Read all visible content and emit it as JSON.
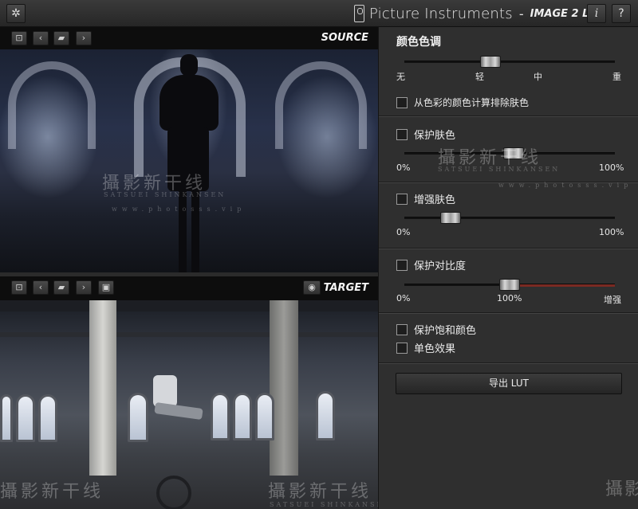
{
  "titlebar": {
    "brand_name": "Picture Instruments",
    "dash": "-",
    "product": "IMAGE 2 LUT",
    "info_label": "i",
    "help_label": "?"
  },
  "source_pane": {
    "label": "SOURCE"
  },
  "target_pane": {
    "label": "TARGET"
  },
  "watermark": {
    "main": "攝影新干线",
    "sub": "SATSUEI SHINKANSEN",
    "url": "www.photosss.vip"
  },
  "panel": {
    "color_tone": {
      "title": "颜色色调",
      "value": 0.41,
      "ticks": [
        "无",
        "轻",
        "中",
        "重"
      ],
      "exclude_skin_label": "从色彩的颜色计算排除肤色",
      "exclude_skin_checked": false
    },
    "protect_skin": {
      "label": "保护肤色",
      "checked": false,
      "value": 0.52,
      "min_label": "0%",
      "max_label": "100%"
    },
    "enhance_skin": {
      "label": "增强肤色",
      "checked": false,
      "value": 0.22,
      "min_label": "0%",
      "max_label": "100%"
    },
    "protect_contrast": {
      "label": "保护对比度",
      "checked": false,
      "value": 0.5,
      "min_label": "0%",
      "mid_label": "100%",
      "max_label": "增强"
    },
    "protect_saturation": {
      "label": "保护饱和颜色",
      "checked": false
    },
    "monochrome": {
      "label": "单色效果",
      "checked": false
    },
    "export_label": "导出 LUT"
  },
  "colors": {
    "accent_fill": "#7a2a22",
    "panel_bg": "#2f2f2f"
  }
}
